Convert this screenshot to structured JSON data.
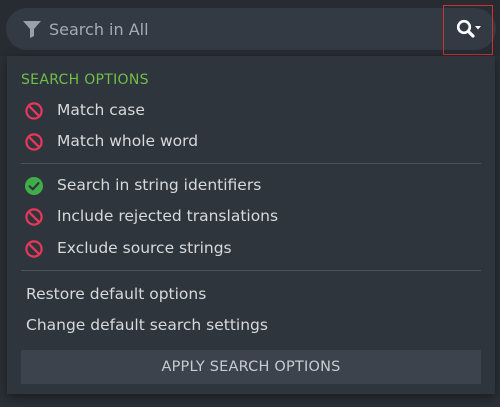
{
  "search": {
    "placeholder": "Search in All",
    "value": ""
  },
  "icons": {
    "filter": "filter-icon",
    "search_toggle": "search-icon",
    "disabled": "no-entry-icon",
    "enabled": "check-circle-icon"
  },
  "colors": {
    "enabled": "#3fae49",
    "disabled": "#e8375b",
    "section_title": "#6fbf4a",
    "highlight_border": "#d0312d"
  },
  "panel": {
    "section_title": "SEARCH OPTIONS",
    "group1": [
      {
        "label": "Match case",
        "enabled": false
      },
      {
        "label": "Match whole word",
        "enabled": false
      }
    ],
    "group2": [
      {
        "label": "Search in string identifiers",
        "enabled": true
      },
      {
        "label": "Include rejected translations",
        "enabled": false
      },
      {
        "label": "Exclude source strings",
        "enabled": false
      }
    ],
    "links": {
      "restore": "Restore default options",
      "change": "Change default search settings"
    },
    "apply_label": "APPLY SEARCH OPTIONS"
  }
}
